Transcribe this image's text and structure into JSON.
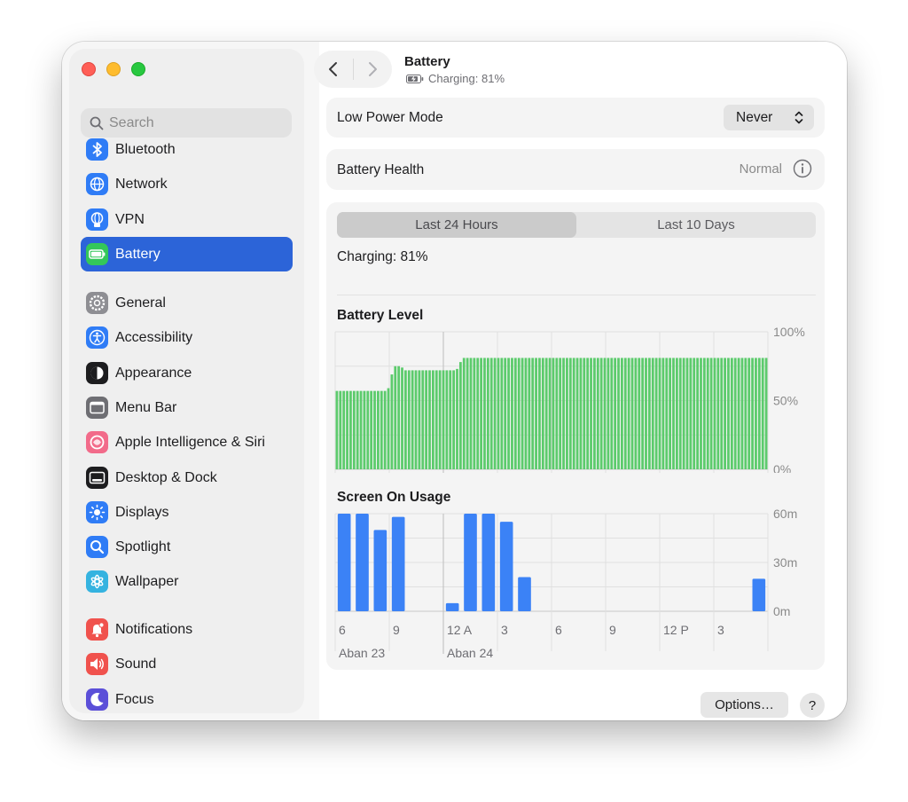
{
  "window": {
    "title": "Battery",
    "subtitle": "Charging: 81%"
  },
  "colors": {
    "accent": "#2c64d8",
    "battery": "#5ccb6c",
    "usage": "#3b82f6"
  },
  "sidebar": {
    "search_placeholder": "Search",
    "groups": [
      [
        {
          "id": "bluetooth",
          "label": "Bluetooth",
          "icon": "bluetooth-icon",
          "color": "#2f7cf6"
        },
        {
          "id": "network",
          "label": "Network",
          "icon": "globe-icon",
          "color": "#2f7cf6"
        },
        {
          "id": "vpn",
          "label": "VPN",
          "icon": "vpn-globe-icon",
          "color": "#2f7cf6"
        },
        {
          "id": "battery",
          "label": "Battery",
          "icon": "battery-icon",
          "color": "#34c759",
          "selected": true
        }
      ],
      [
        {
          "id": "general",
          "label": "General",
          "icon": "gear-icon",
          "color": "#8e8e93"
        },
        {
          "id": "accessibility",
          "label": "Accessibility",
          "icon": "accessibility-icon",
          "color": "#2f7cf6"
        },
        {
          "id": "appearance",
          "label": "Appearance",
          "icon": "appearance-icon",
          "color": "#1d1d1f"
        },
        {
          "id": "menu-bar",
          "label": "Menu Bar",
          "icon": "menu-bar-icon",
          "color": "#6e6e73"
        },
        {
          "id": "apple-intelligence",
          "label": "Apple Intelligence & Siri",
          "icon": "siri-icon",
          "color": "#f26b8a"
        },
        {
          "id": "desktop-dock",
          "label": "Desktop & Dock",
          "icon": "dock-icon",
          "color": "#1d1d1f"
        },
        {
          "id": "displays",
          "label": "Displays",
          "icon": "sun-icon",
          "color": "#2f7cf6"
        },
        {
          "id": "spotlight",
          "label": "Spotlight",
          "icon": "magnifier-icon",
          "color": "#2f7cf6"
        },
        {
          "id": "wallpaper",
          "label": "Wallpaper",
          "icon": "flower-icon",
          "color": "#35b3e0"
        }
      ],
      [
        {
          "id": "notifications",
          "label": "Notifications",
          "icon": "bell-icon",
          "color": "#f0524d"
        },
        {
          "id": "sound",
          "label": "Sound",
          "icon": "speaker-icon",
          "color": "#f0524d"
        },
        {
          "id": "focus",
          "label": "Focus",
          "icon": "moon-icon",
          "color": "#5b4fd8"
        }
      ]
    ]
  },
  "low_power": {
    "label": "Low Power Mode",
    "value": "Never"
  },
  "health": {
    "label": "Battery Health",
    "value": "Normal"
  },
  "tabs": [
    {
      "label": "Last 24 Hours",
      "active": true
    },
    {
      "label": "Last 10 Days",
      "active": false
    }
  ],
  "status_text": "Charging: 81%",
  "options_button": "Options…",
  "help_button": "?",
  "chart_data": [
    {
      "type": "bar",
      "title": "Battery Level",
      "unit": "%",
      "ylim": [
        0,
        100
      ],
      "y_ticks": [
        "100%",
        "50%",
        "0%"
      ],
      "x_tick_labels": [
        "6",
        "9",
        "12 A",
        "3",
        "6",
        "9",
        "12 P",
        "3"
      ],
      "values": [
        57,
        57,
        57,
        57,
        57,
        57,
        57,
        57,
        57,
        57,
        57,
        57,
        57,
        57,
        57,
        59,
        69,
        75,
        75,
        74,
        72,
        72,
        72,
        72,
        72,
        72,
        72,
        72,
        72,
        72,
        72,
        72,
        72,
        72,
        72,
        73,
        78,
        81,
        81,
        81,
        81,
        81,
        81,
        81,
        81,
        81,
        81,
        81,
        81,
        81,
        81,
        81,
        81,
        81,
        81,
        81,
        81,
        81,
        81,
        81,
        81,
        81,
        81,
        81,
        81,
        81,
        81,
        81,
        81,
        81,
        81,
        81,
        81,
        81,
        81,
        81,
        81,
        81,
        81,
        81,
        81,
        81,
        81,
        81,
        81,
        81,
        81,
        81,
        81,
        81,
        81,
        81,
        81,
        81,
        81,
        81,
        81,
        81,
        81,
        81,
        81,
        81,
        81,
        81,
        81,
        81,
        81,
        81,
        81,
        81,
        81,
        81,
        81,
        81,
        81,
        81,
        81,
        81,
        81,
        81,
        81,
        81,
        81,
        81,
        81,
        81
      ],
      "grid": true
    },
    {
      "type": "bar",
      "title": "Screen On Usage",
      "unit": "min",
      "ylim": [
        0,
        60
      ],
      "y_ticks": [
        "60m",
        "30m",
        "0m"
      ],
      "x_tick_labels": [
        "6",
        "9",
        "12 A",
        "3",
        "6",
        "9",
        "12 P",
        "3"
      ],
      "date_labels": [
        "Aban 23",
        "Aban 24"
      ],
      "values": [
        60,
        60,
        50,
        58,
        0,
        0,
        5,
        60,
        60,
        55,
        21,
        0,
        0,
        0,
        0,
        0,
        0,
        0,
        0,
        0,
        0,
        0,
        0,
        20
      ],
      "grid": true
    }
  ]
}
